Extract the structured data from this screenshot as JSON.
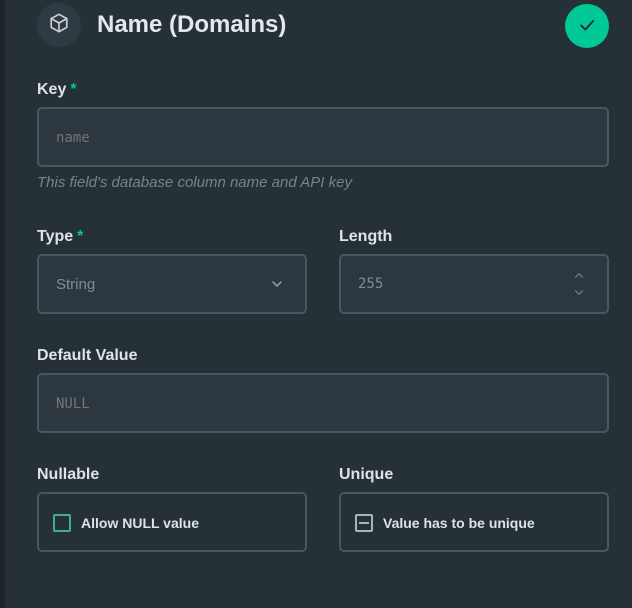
{
  "header": {
    "title": "Name (Domains)",
    "icon": "box-icon",
    "save_icon": "check-icon"
  },
  "key": {
    "label": "Key",
    "required_mark": "*",
    "placeholder": "name",
    "hint": "This field's database column name and API key"
  },
  "type": {
    "label": "Type",
    "required_mark": "*",
    "value": "String"
  },
  "length": {
    "label": "Length",
    "value": "255"
  },
  "default_value": {
    "label": "Default Value",
    "placeholder": "NULL"
  },
  "nullable": {
    "label": "Nullable",
    "checkbox_label": "Allow NULL value"
  },
  "unique": {
    "label": "Unique",
    "checkbox_label": "Value has to be unique"
  },
  "colors": {
    "background": "#263037",
    "accent": "#00c897",
    "border": "#4a5761",
    "text": "#dde3e8",
    "muted": "#7f8c96"
  }
}
